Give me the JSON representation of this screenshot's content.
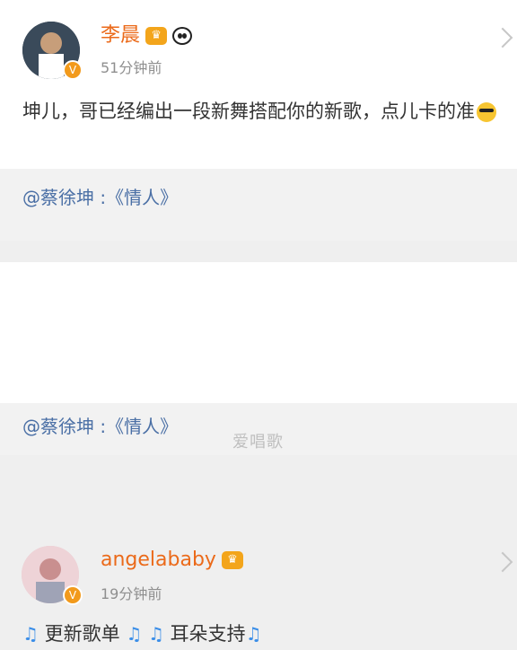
{
  "posts": [
    {
      "username": "李晨",
      "timestamp": "51分钟前",
      "body": "坤儿，哥已经编出一段新舞搭配你的新歌，点儿卡的准",
      "quote": "@蔡徐坤 :《情人》"
    },
    {
      "username": "angelababy",
      "timestamp": "19分钟前",
      "body_parts": [
        "更新歌单",
        "耳朵支持"
      ],
      "quote": "@蔡徐坤 :《情人》"
    }
  ],
  "watermark": "爱唱歌",
  "colors": {
    "username": "#eb6a1a",
    "link": "#4a6fa5",
    "verified": "#f29a1c",
    "music": "#3b8ee8"
  },
  "icons": {
    "vip_crown": "crown-icon",
    "panda_emoji": "panda-icon",
    "music_note": "music-note-icon",
    "cool_emoji": "sunglasses-face-icon",
    "verified_badge": "verified-v-icon",
    "chevron": "chevron-down-icon"
  }
}
